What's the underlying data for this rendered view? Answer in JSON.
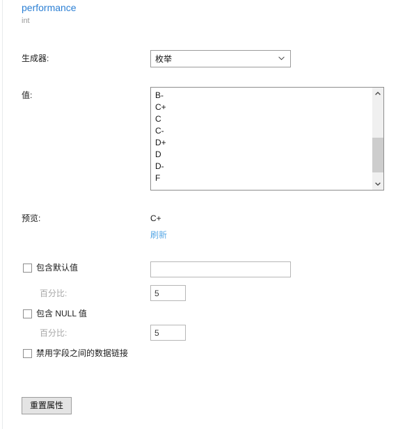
{
  "field": {
    "name": "performance",
    "type": "int",
    "name_color": "#2b7fd4",
    "type_color": "#9a9a9a"
  },
  "generator": {
    "label": "生成器:",
    "selected": "枚举",
    "chevron_icon": "chevron-down-icon"
  },
  "values": {
    "label": "值:",
    "items": [
      "B-",
      "C+",
      "C",
      "C-",
      "D+",
      "D",
      "D-",
      "F"
    ],
    "scrollbar": {
      "up_icon": "chevron-up-icon",
      "down_icon": "chevron-down-icon"
    }
  },
  "preview": {
    "label": "预览:",
    "value": "C+",
    "refresh_label": "刷新",
    "refresh_color": "#5aa9e6"
  },
  "options": {
    "include_default": {
      "label": "包含默认值",
      "checked": false,
      "value": "",
      "placeholder": ""
    },
    "default_percent": {
      "label": "百分比:",
      "value": "5",
      "disabled": true
    },
    "include_null": {
      "label": "包含 NULL 值",
      "checked": false
    },
    "null_percent": {
      "label": "百分比:",
      "value": "5",
      "disabled": true
    },
    "disable_datalink": {
      "label": "禁用字段之间的数据链接",
      "checked": false
    }
  },
  "actions": {
    "reset_label": "重置属性"
  }
}
